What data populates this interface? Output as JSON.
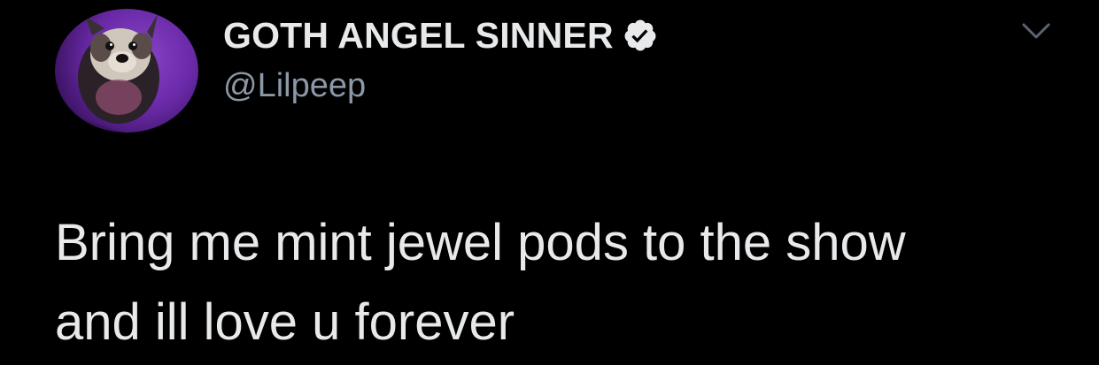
{
  "tweet": {
    "author": {
      "display_name": "GOTH ANGEL SINNER",
      "handle": "@Lilpeep",
      "verified": true,
      "avatar_icon": "dog-avatar"
    },
    "text_lines": [
      "Bring me mint jewel pods to the show",
      "and ill love u forever"
    ],
    "menu_icon": "chevron-down-icon"
  },
  "colors": {
    "background": "#000000",
    "text_primary": "#e7e9ea",
    "text_secondary": "#8b98a5",
    "avatar_purple": "#6a2aa8"
  }
}
